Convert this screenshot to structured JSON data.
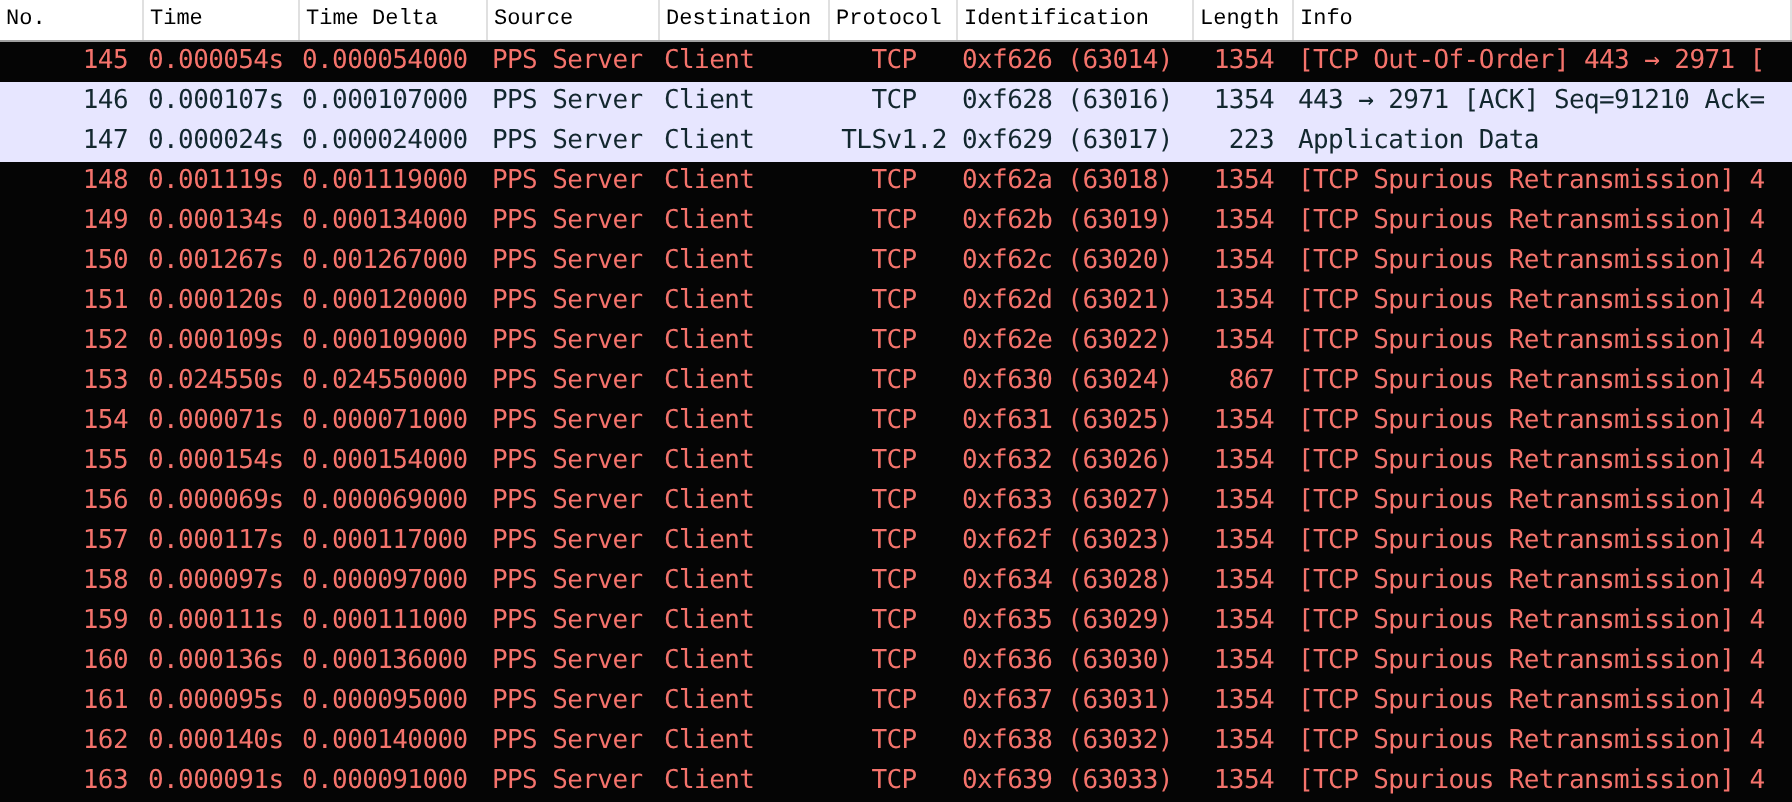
{
  "table": {
    "columns": [
      "No.",
      "Time",
      "Time Delta",
      "Source",
      "Destination",
      "Protocol",
      "Identification",
      "Length",
      "Info"
    ],
    "rows": [
      {
        "kind": "bad",
        "cells": [
          "145",
          "0.000054s",
          "0.000054000",
          "PPS Server",
          "Client",
          "TCP",
          "0xf626 (63014)",
          "1354",
          "[TCP Out-Of-Order] 443 → 2971 ["
        ]
      },
      {
        "kind": "normal",
        "cells": [
          "146",
          "0.000107s",
          "0.000107000",
          "PPS Server",
          "Client",
          "TCP",
          "0xf628 (63016)",
          "1354",
          "443 → 2971 [ACK] Seq=91210 Ack="
        ]
      },
      {
        "kind": "normal",
        "cells": [
          "147",
          "0.000024s",
          "0.000024000",
          "PPS Server",
          "Client",
          "TLSv1.2",
          "0xf629 (63017)",
          "223",
          "Application Data"
        ]
      },
      {
        "kind": "bad",
        "cells": [
          "148",
          "0.001119s",
          "0.001119000",
          "PPS Server",
          "Client",
          "TCP",
          "0xf62a (63018)",
          "1354",
          "[TCP Spurious Retransmission] 4"
        ]
      },
      {
        "kind": "bad",
        "cells": [
          "149",
          "0.000134s",
          "0.000134000",
          "PPS Server",
          "Client",
          "TCP",
          "0xf62b (63019)",
          "1354",
          "[TCP Spurious Retransmission] 4"
        ]
      },
      {
        "kind": "bad",
        "cells": [
          "150",
          "0.001267s",
          "0.001267000",
          "PPS Server",
          "Client",
          "TCP",
          "0xf62c (63020)",
          "1354",
          "[TCP Spurious Retransmission] 4"
        ]
      },
      {
        "kind": "bad",
        "cells": [
          "151",
          "0.000120s",
          "0.000120000",
          "PPS Server",
          "Client",
          "TCP",
          "0xf62d (63021)",
          "1354",
          "[TCP Spurious Retransmission] 4"
        ]
      },
      {
        "kind": "bad",
        "cells": [
          "152",
          "0.000109s",
          "0.000109000",
          "PPS Server",
          "Client",
          "TCP",
          "0xf62e (63022)",
          "1354",
          "[TCP Spurious Retransmission] 4"
        ]
      },
      {
        "kind": "bad",
        "cells": [
          "153",
          "0.024550s",
          "0.024550000",
          "PPS Server",
          "Client",
          "TCP",
          "0xf630 (63024)",
          "867",
          "[TCP Spurious Retransmission] 4"
        ]
      },
      {
        "kind": "bad",
        "cells": [
          "154",
          "0.000071s",
          "0.000071000",
          "PPS Server",
          "Client",
          "TCP",
          "0xf631 (63025)",
          "1354",
          "[TCP Spurious Retransmission] 4"
        ]
      },
      {
        "kind": "bad",
        "cells": [
          "155",
          "0.000154s",
          "0.000154000",
          "PPS Server",
          "Client",
          "TCP",
          "0xf632 (63026)",
          "1354",
          "[TCP Spurious Retransmission] 4"
        ]
      },
      {
        "kind": "bad",
        "cells": [
          "156",
          "0.000069s",
          "0.000069000",
          "PPS Server",
          "Client",
          "TCP",
          "0xf633 (63027)",
          "1354",
          "[TCP Spurious Retransmission] 4"
        ]
      },
      {
        "kind": "bad",
        "cells": [
          "157",
          "0.000117s",
          "0.000117000",
          "PPS Server",
          "Client",
          "TCP",
          "0xf62f (63023)",
          "1354",
          "[TCP Spurious Retransmission] 4"
        ]
      },
      {
        "kind": "bad",
        "cells": [
          "158",
          "0.000097s",
          "0.000097000",
          "PPS Server",
          "Client",
          "TCP",
          "0xf634 (63028)",
          "1354",
          "[TCP Spurious Retransmission] 4"
        ]
      },
      {
        "kind": "bad",
        "cells": [
          "159",
          "0.000111s",
          "0.000111000",
          "PPS Server",
          "Client",
          "TCP",
          "0xf635 (63029)",
          "1354",
          "[TCP Spurious Retransmission] 4"
        ]
      },
      {
        "kind": "bad",
        "cells": [
          "160",
          "0.000136s",
          "0.000136000",
          "PPS Server",
          "Client",
          "TCP",
          "0xf636 (63030)",
          "1354",
          "[TCP Spurious Retransmission] 4"
        ]
      },
      {
        "kind": "bad",
        "cells": [
          "161",
          "0.000095s",
          "0.000095000",
          "PPS Server",
          "Client",
          "TCP",
          "0xf637 (63031)",
          "1354",
          "[TCP Spurious Retransmission] 4"
        ]
      },
      {
        "kind": "bad",
        "cells": [
          "162",
          "0.000140s",
          "0.000140000",
          "PPS Server",
          "Client",
          "TCP",
          "0xf638 (63032)",
          "1354",
          "[TCP Spurious Retransmission] 4"
        ]
      },
      {
        "kind": "bad",
        "cells": [
          "163",
          "0.000091s",
          "0.000091000",
          "PPS Server",
          "Client",
          "TCP",
          "0xf639 (63033)",
          "1354",
          "[TCP Spurious Retransmission] 4"
        ]
      }
    ]
  }
}
